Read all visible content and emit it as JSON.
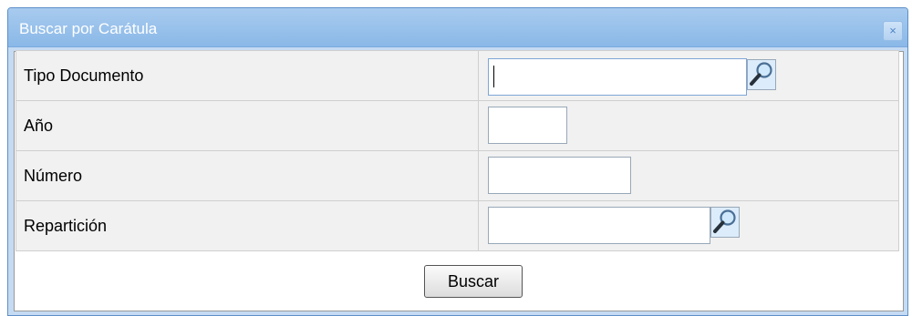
{
  "dialog": {
    "title": "Buscar por Carátula",
    "close_label": "×"
  },
  "form": {
    "fields": [
      {
        "label": "Tipo Documento",
        "value": "",
        "has_lookup": true,
        "focused": true
      },
      {
        "label": "Año",
        "value": ""
      },
      {
        "label": "Número",
        "value": ""
      },
      {
        "label": "Repartición",
        "value": "",
        "has_lookup": true
      }
    ],
    "submit_label": "Buscar"
  },
  "icons": {
    "lookup": "magnifier-icon",
    "close": "close-icon"
  },
  "colors": {
    "titlebar": "#8ab8e7",
    "frame": "#c5dbf3",
    "cell_bg": "#f1f1f1"
  }
}
